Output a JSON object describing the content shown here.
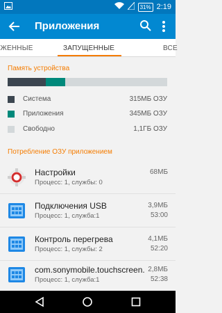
{
  "status_bar": {
    "time": "2:19",
    "battery": "31%",
    "icons": [
      "image-icon",
      "wifi-icon",
      "signal-icon",
      "battery-icon"
    ]
  },
  "app_bar": {
    "title": "Приложения",
    "icons": [
      "back-icon",
      "search-icon",
      "more-icon"
    ]
  },
  "tabs": [
    {
      "label": "УЖЕННЫЕ",
      "selected": false
    },
    {
      "label": "ЗАПУЩЕННЫЕ",
      "selected": true
    },
    {
      "label": "ВСЕ",
      "selected": false
    }
  ],
  "device_memory": {
    "heading": "Память устройства",
    "bar": {
      "system_fraction": 0.24,
      "apps_fraction": 0.12
    },
    "legend": [
      {
        "label": "Система",
        "value": "315МБ ОЗУ",
        "color": "#3c4650"
      },
      {
        "label": "Приложения",
        "value": "345МБ ОЗУ",
        "color": "#00897b"
      },
      {
        "label": "Свободно",
        "value": "1,1ГБ ОЗУ",
        "color": "#d3d8da"
      }
    ]
  },
  "ram_usage": {
    "heading": "Потребление ОЗУ приложением",
    "apps": [
      {
        "name": "Настройки",
        "subtitle": "Процесс: 1, службы: 0",
        "size": "68МБ",
        "time": "",
        "icon": "settings-icon"
      },
      {
        "name": "Подключения USB",
        "subtitle": "Процесс: 1, служба:1",
        "size": "3,9МБ",
        "time": "53:00",
        "icon": "android-app-icon"
      },
      {
        "name": "Контроль перегрева",
        "subtitle": "Процесс: 1, службы: 2",
        "size": "4,1МБ",
        "time": "52:20",
        "icon": "android-app-icon"
      },
      {
        "name": "com.sonymobile.touchscreen.",
        "subtitle": "Процесс: 1, служба:1",
        "size": "2,8МБ",
        "time": "52:38",
        "icon": "android-app-icon"
      }
    ]
  },
  "nav_bar": {
    "icons": [
      "back-triangle-icon",
      "home-circle-icon",
      "recents-square-icon"
    ]
  },
  "colors": {
    "status_bar": "#0277bd",
    "app_bar": "#0288d1",
    "accent": "#f57c00"
  }
}
